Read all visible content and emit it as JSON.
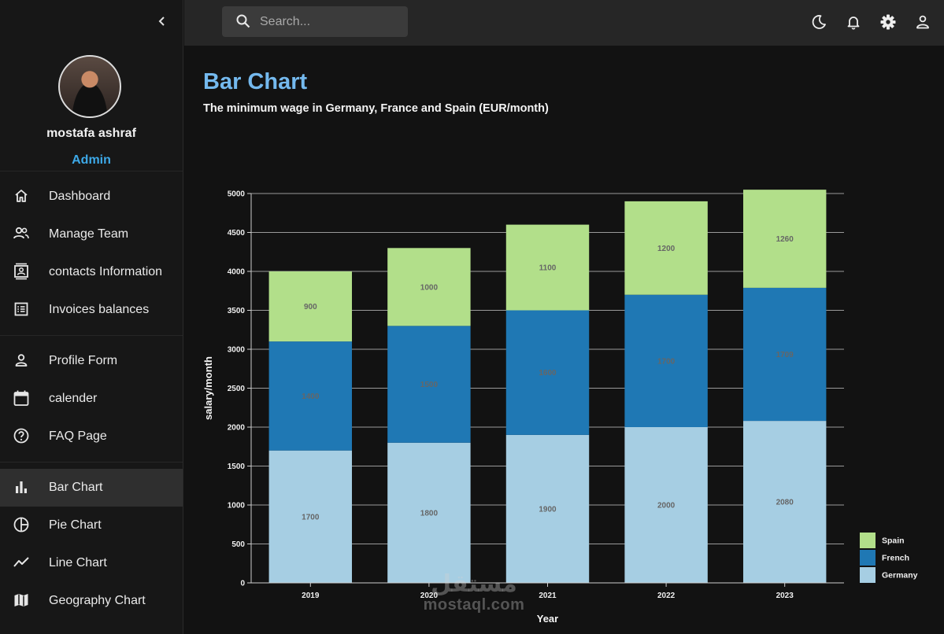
{
  "topbar": {
    "search_placeholder": "Search..."
  },
  "sidebar": {
    "user": {
      "name": "mostafa ashraf",
      "role": "Admin"
    },
    "items": [
      {
        "label": "Dashboard",
        "icon": "home-icon"
      },
      {
        "label": "Manage Team",
        "icon": "people-icon"
      },
      {
        "label": "contacts Information",
        "icon": "contacts-icon"
      },
      {
        "label": "Invoices balances",
        "icon": "receipt-icon"
      },
      {
        "label": "Profile Form",
        "icon": "person-icon"
      },
      {
        "label": "calender",
        "icon": "calendar-icon"
      },
      {
        "label": "FAQ Page",
        "icon": "help-icon"
      },
      {
        "label": "Bar Chart",
        "icon": "bar-chart-icon",
        "active": true
      },
      {
        "label": "Pie Chart",
        "icon": "pie-chart-icon"
      },
      {
        "label": "Line Chart",
        "icon": "line-chart-icon"
      },
      {
        "label": "Geography Chart",
        "icon": "map-icon"
      }
    ]
  },
  "page": {
    "title": "Bar Chart",
    "subtitle": "The minimum wage in Germany, France and Spain (EUR/month)"
  },
  "watermark": {
    "arabic": "مستقل",
    "latin": "mostaql.com"
  },
  "colors": {
    "accent_title": "#74b9ee",
    "role": "#3da9e8",
    "spain": "#b2df8a",
    "french": "#1f78b4",
    "germany": "#a6cee3"
  },
  "chart_data": {
    "type": "bar",
    "stacked": true,
    "categories": [
      "2019",
      "2020",
      "2021",
      "2022",
      "2023"
    ],
    "series": [
      {
        "name": "Germany",
        "values": [
          1700,
          1800,
          1900,
          2000,
          2080
        ],
        "color": "#a6cee3"
      },
      {
        "name": "French",
        "values": [
          1400,
          1500,
          1600,
          1700,
          1709
        ],
        "color": "#1f78b4"
      },
      {
        "name": "Spain",
        "values": [
          900,
          1000,
          1100,
          1200,
          1260
        ],
        "color": "#b2df8a"
      }
    ],
    "xlabel": "Year",
    "ylabel": "salary/month",
    "ylim": [
      0,
      5000
    ],
    "yticks": [
      "0",
      "500",
      "1000",
      "1500",
      "2000",
      "2500",
      "3000",
      "3500",
      "4000",
      "4500",
      "5000"
    ],
    "grid": true,
    "legend_position": "bottom-right",
    "legend_order": [
      "Spain",
      "French",
      "Germany"
    ]
  }
}
